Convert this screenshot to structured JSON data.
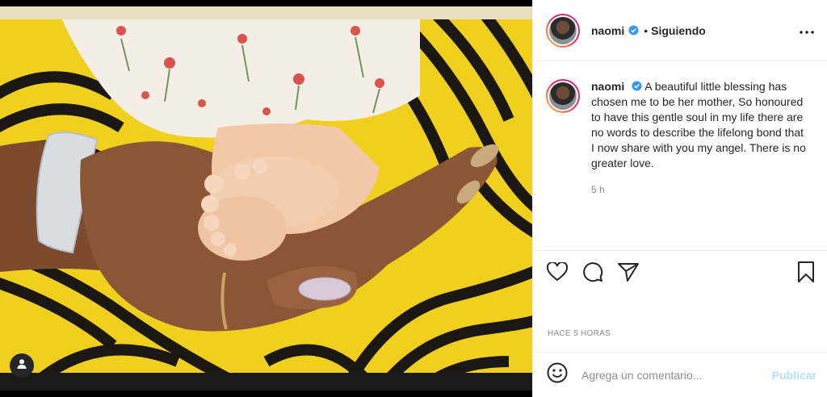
{
  "post": {
    "username": "naomi",
    "follow_status": "Siguiendo",
    "separator": "•",
    "caption_username": "naomi",
    "caption_text": "A beautiful little blessing has chosen me to be her mother, So honoured to have this gentle soul in my life there are no words to describe the lifelong bond that I now share with you my angel. There is no greater love.",
    "caption_age": "5 h",
    "post_date": "HACE 5 HORAS"
  },
  "comment": {
    "placeholder": "Agrega un comentario...",
    "publish_label": "Publicar"
  },
  "colors": {
    "verified_badge": "#3897f0",
    "publish_disabled": "#b2dffc",
    "fabric_yellow": "#f2d21c",
    "skin": "#8a5a3c"
  },
  "icons": {
    "more": "more-options-icon",
    "like": "heart-icon",
    "comment": "comment-bubble-icon",
    "share": "paper-plane-icon",
    "save": "bookmark-icon",
    "emoji": "smiley-icon",
    "tag": "user-tag-icon"
  }
}
